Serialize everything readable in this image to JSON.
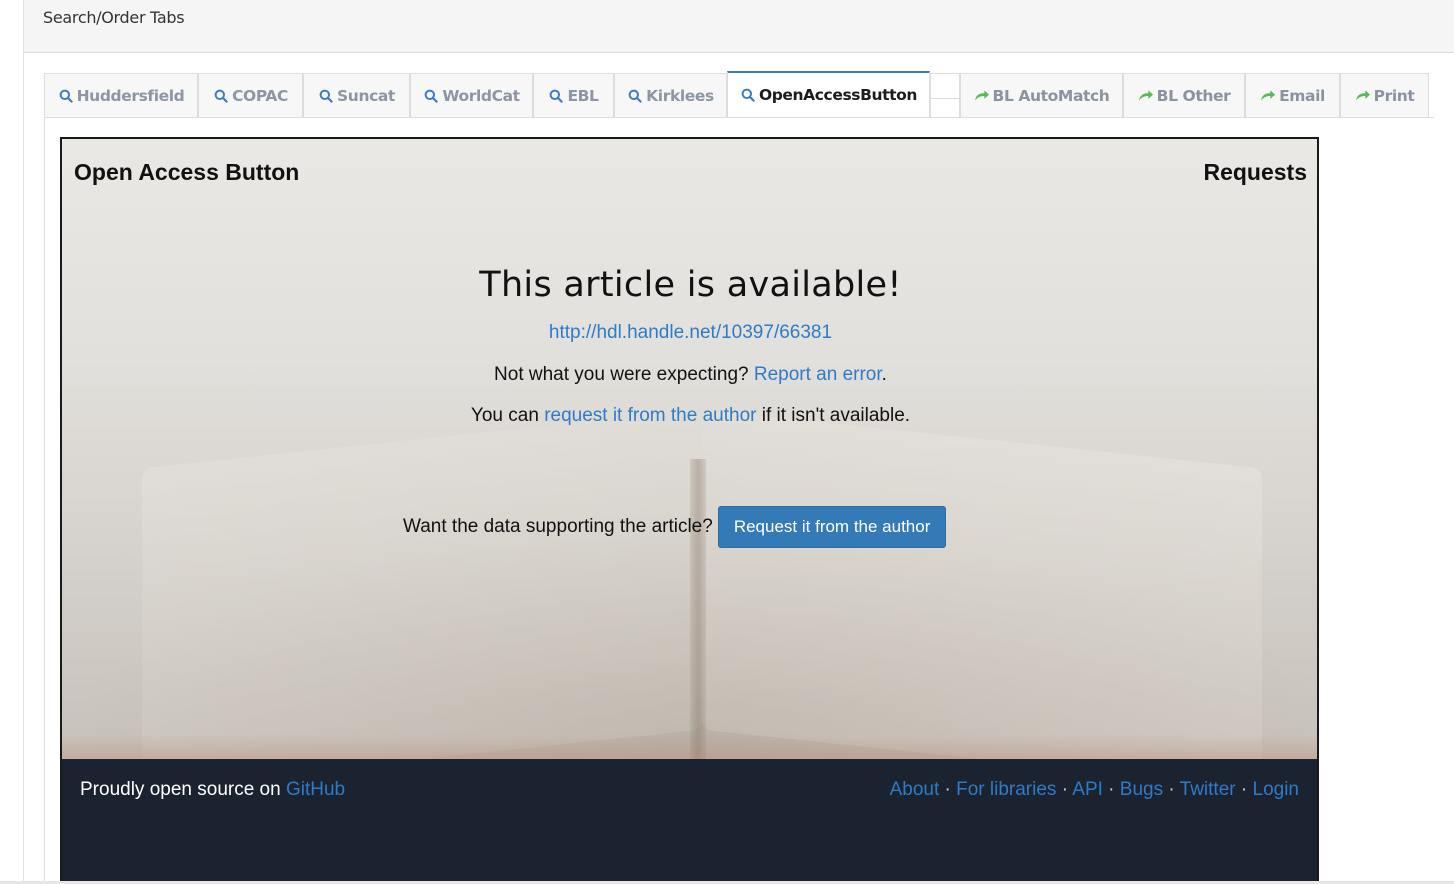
{
  "panel": {
    "title": "Search/Order Tabs"
  },
  "tabs": [
    {
      "label": "Huddersfield",
      "icon": "search-icon",
      "kind": "search",
      "active": false
    },
    {
      "label": "COPAC",
      "icon": "search-icon",
      "kind": "search",
      "active": false
    },
    {
      "label": "Suncat",
      "icon": "search-icon",
      "kind": "search",
      "active": false
    },
    {
      "label": "WorldCat",
      "icon": "search-icon",
      "kind": "search",
      "active": false
    },
    {
      "label": "EBL",
      "icon": "search-icon",
      "kind": "search",
      "active": false
    },
    {
      "label": "Kirklees",
      "icon": "search-icon",
      "kind": "search",
      "active": false
    },
    {
      "label": "OpenAccessButton",
      "icon": "search-icon",
      "kind": "search",
      "active": true
    },
    {
      "label": "BL AutoMatch",
      "icon": "share-arrow-icon",
      "kind": "order",
      "active": false
    },
    {
      "label": "BL Other",
      "icon": "share-arrow-icon",
      "kind": "order",
      "active": false
    },
    {
      "label": "Email",
      "icon": "share-arrow-icon",
      "kind": "order",
      "active": false
    },
    {
      "label": "Print",
      "icon": "share-arrow-icon",
      "kind": "order",
      "active": false
    }
  ],
  "oab": {
    "brand": "Open Access Button",
    "requests": "Requests",
    "headline": "This article is available!",
    "url": "http://hdl.handle.net/10397/66381",
    "error_prefix": "Not what you were expecting? ",
    "error_link": "Report an error",
    "error_suffix": ".",
    "request_prefix": "You can ",
    "request_link": "request it from the author",
    "request_suffix": " if it isn't available.",
    "data_prompt": "Want the data supporting the article?",
    "data_button": "Request it from the author"
  },
  "footer": {
    "left_text": "Proudly open source on ",
    "left_link": "GitHub",
    "links": [
      "About",
      "For libraries",
      "API",
      "Bugs",
      "Twitter",
      "Login"
    ],
    "separator": " · "
  },
  "colors": {
    "link": "#2f7bc8",
    "primary_button": "#337ab7",
    "footer_bg": "#1b2330",
    "tab_icon_search": "#3c7cc3",
    "tab_icon_order": "#5cb85c"
  }
}
